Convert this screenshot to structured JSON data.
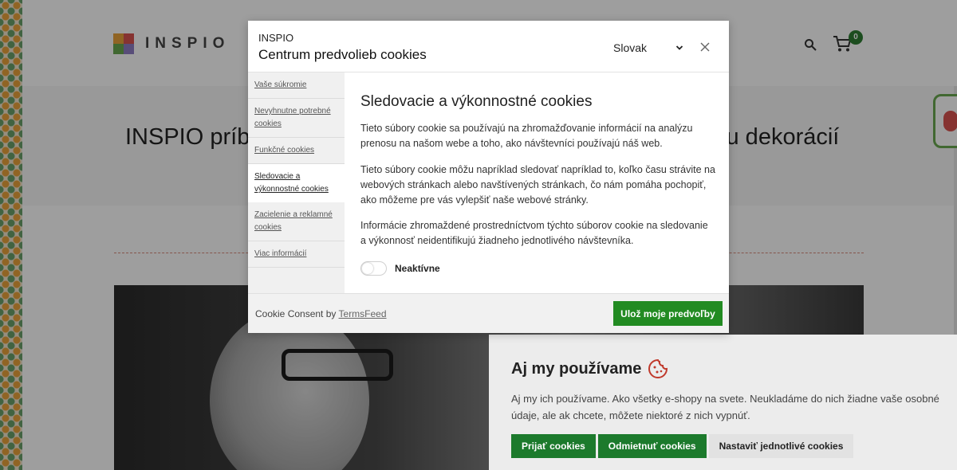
{
  "site": {
    "logo_text": "INSPIO",
    "cart_count": "0",
    "hero_title_left": "INSPIO príb",
    "hero_title_right": "ku dekorácií"
  },
  "banner": {
    "title": "Aj my používame",
    "text": "Aj my ich používame. Ako všetky e-shopy na svete. Neukladáme do nich žiadne vaše osobné údaje, ale ak chcete, môžete niektoré z nich vypnúť.",
    "accept_label": "Prijať cookies",
    "reject_label": "Odmietnuť cookies",
    "customize_label": "Nastaviť jednotlivé cookies"
  },
  "modal": {
    "brand": "INSPIO",
    "title": "Centrum predvolieb cookies",
    "language": "Slovak",
    "tabs": [
      {
        "label": "Vaše súkromie"
      },
      {
        "label": "Nevyhnutne potrebné cookies"
      },
      {
        "label": "Funkčné cookies"
      },
      {
        "label": "Sledovacie a výkonnostné cookies"
      },
      {
        "label": "Zacielenie a reklamné cookies"
      },
      {
        "label": "Viac informácií"
      }
    ],
    "active_tab_index": 3,
    "content": {
      "heading": "Sledovacie a výkonnostné cookies",
      "p1": "Tieto súbory cookie sa používajú na zhromažďovanie informácií na analýzu prenosu na našom webe a toho, ako návštevníci používajú náš web.",
      "p2": "Tieto súbory cookie môžu napríklad sledovať napríklad to, koľko času strávite na webových stránkach alebo navštívených stránkach, čo nám pomáha pochopiť, ako môžeme pre vás vylepšiť naše webové stránky.",
      "p3": "Informácie zhromaždené prostredníctvom týchto súborov cookie na sledovanie a výkonnosť neidentifikujú žiadneho jednotlivého návštevníka.",
      "toggle_label": "Neaktívne"
    },
    "footer": {
      "consent_prefix": "Cookie Consent by ",
      "consent_link": "TermsFeed",
      "save_label": "Ulož moje predvoľby"
    }
  },
  "colors": {
    "accent_green": "#228b22",
    "banner_green": "#1c7a2c",
    "cart_badge": "#2e7d32"
  }
}
